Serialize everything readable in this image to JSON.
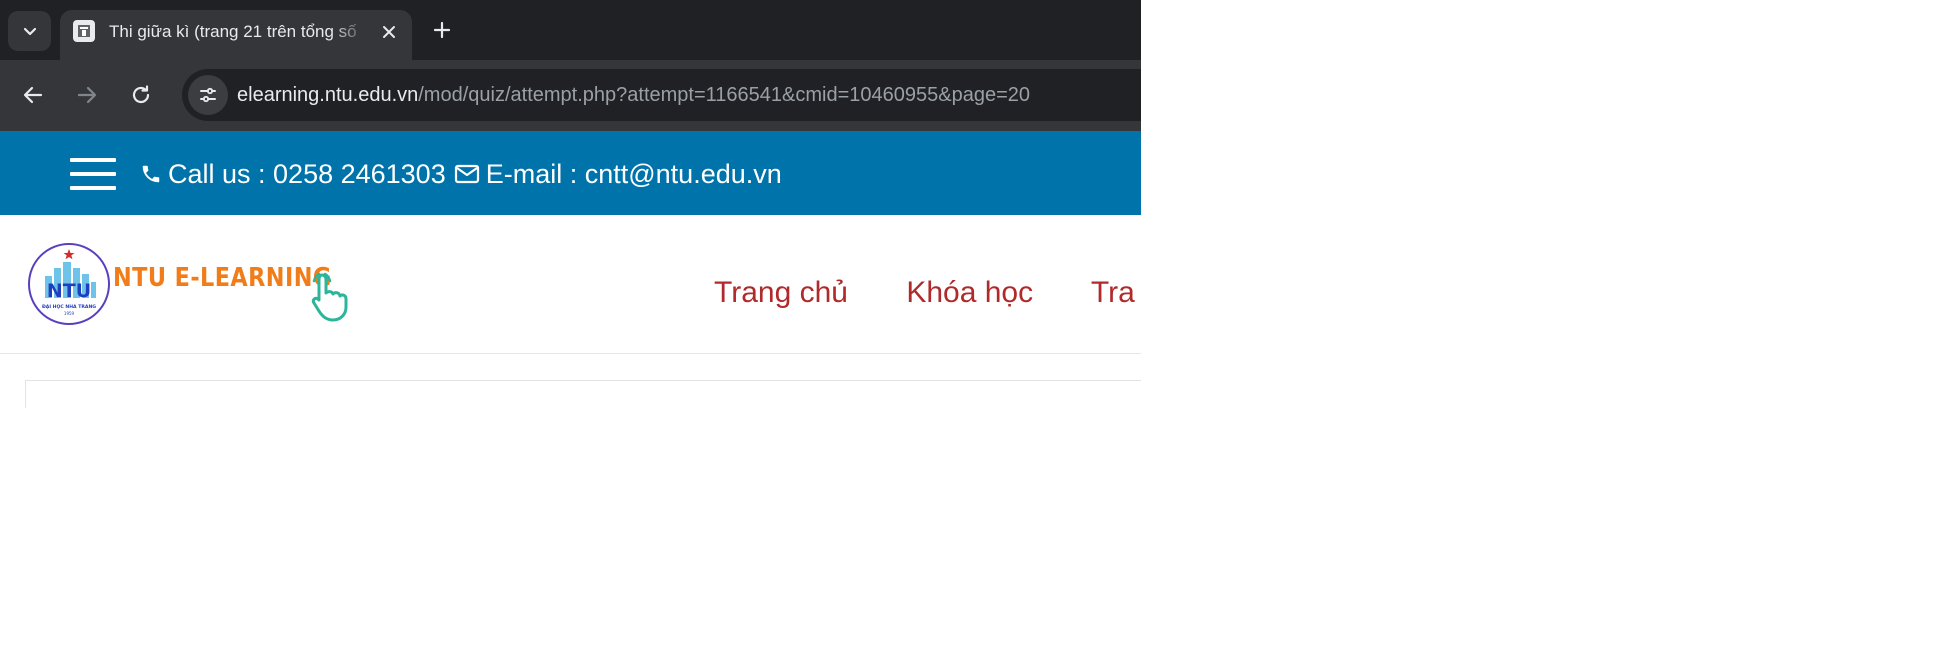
{
  "browser": {
    "tab_title": "Thi giữa kì (trang 21 trên tổng số",
    "url_host": "elearning.ntu.edu.vn",
    "url_path": "/mod/quiz/attempt.php?attempt=1166541&cmid=10460955&page=20"
  },
  "topbar": {
    "call_label": "Call us : 0258 2461303",
    "email_label": "E-mail : cntt@ntu.edu.vn"
  },
  "header": {
    "brand": "NTU E-LEARNING",
    "logo_text": "NTU",
    "logo_subtext": "ĐẠI HỌC NHA TRANG",
    "logo_year": "1959",
    "nav": [
      {
        "label": "Trang chủ"
      },
      {
        "label": "Khóa học"
      },
      {
        "label": "Tra"
      }
    ]
  },
  "colors": {
    "topbar_bg": "#0073aa",
    "brand_orange": "#f07d1a",
    "nav_red": "#b02a2a",
    "chrome_dark": "#202124",
    "chrome_toolbar": "#35363a"
  },
  "icons": {
    "tab_search": "chevron-down-icon",
    "tab_close": "close-icon",
    "new_tab": "plus-icon",
    "back": "arrow-left-icon",
    "forward": "arrow-right-icon",
    "reload": "reload-icon",
    "site_info": "tune-icon",
    "phone": "phone-icon",
    "email": "envelope-icon",
    "menu": "hamburger-icon"
  }
}
